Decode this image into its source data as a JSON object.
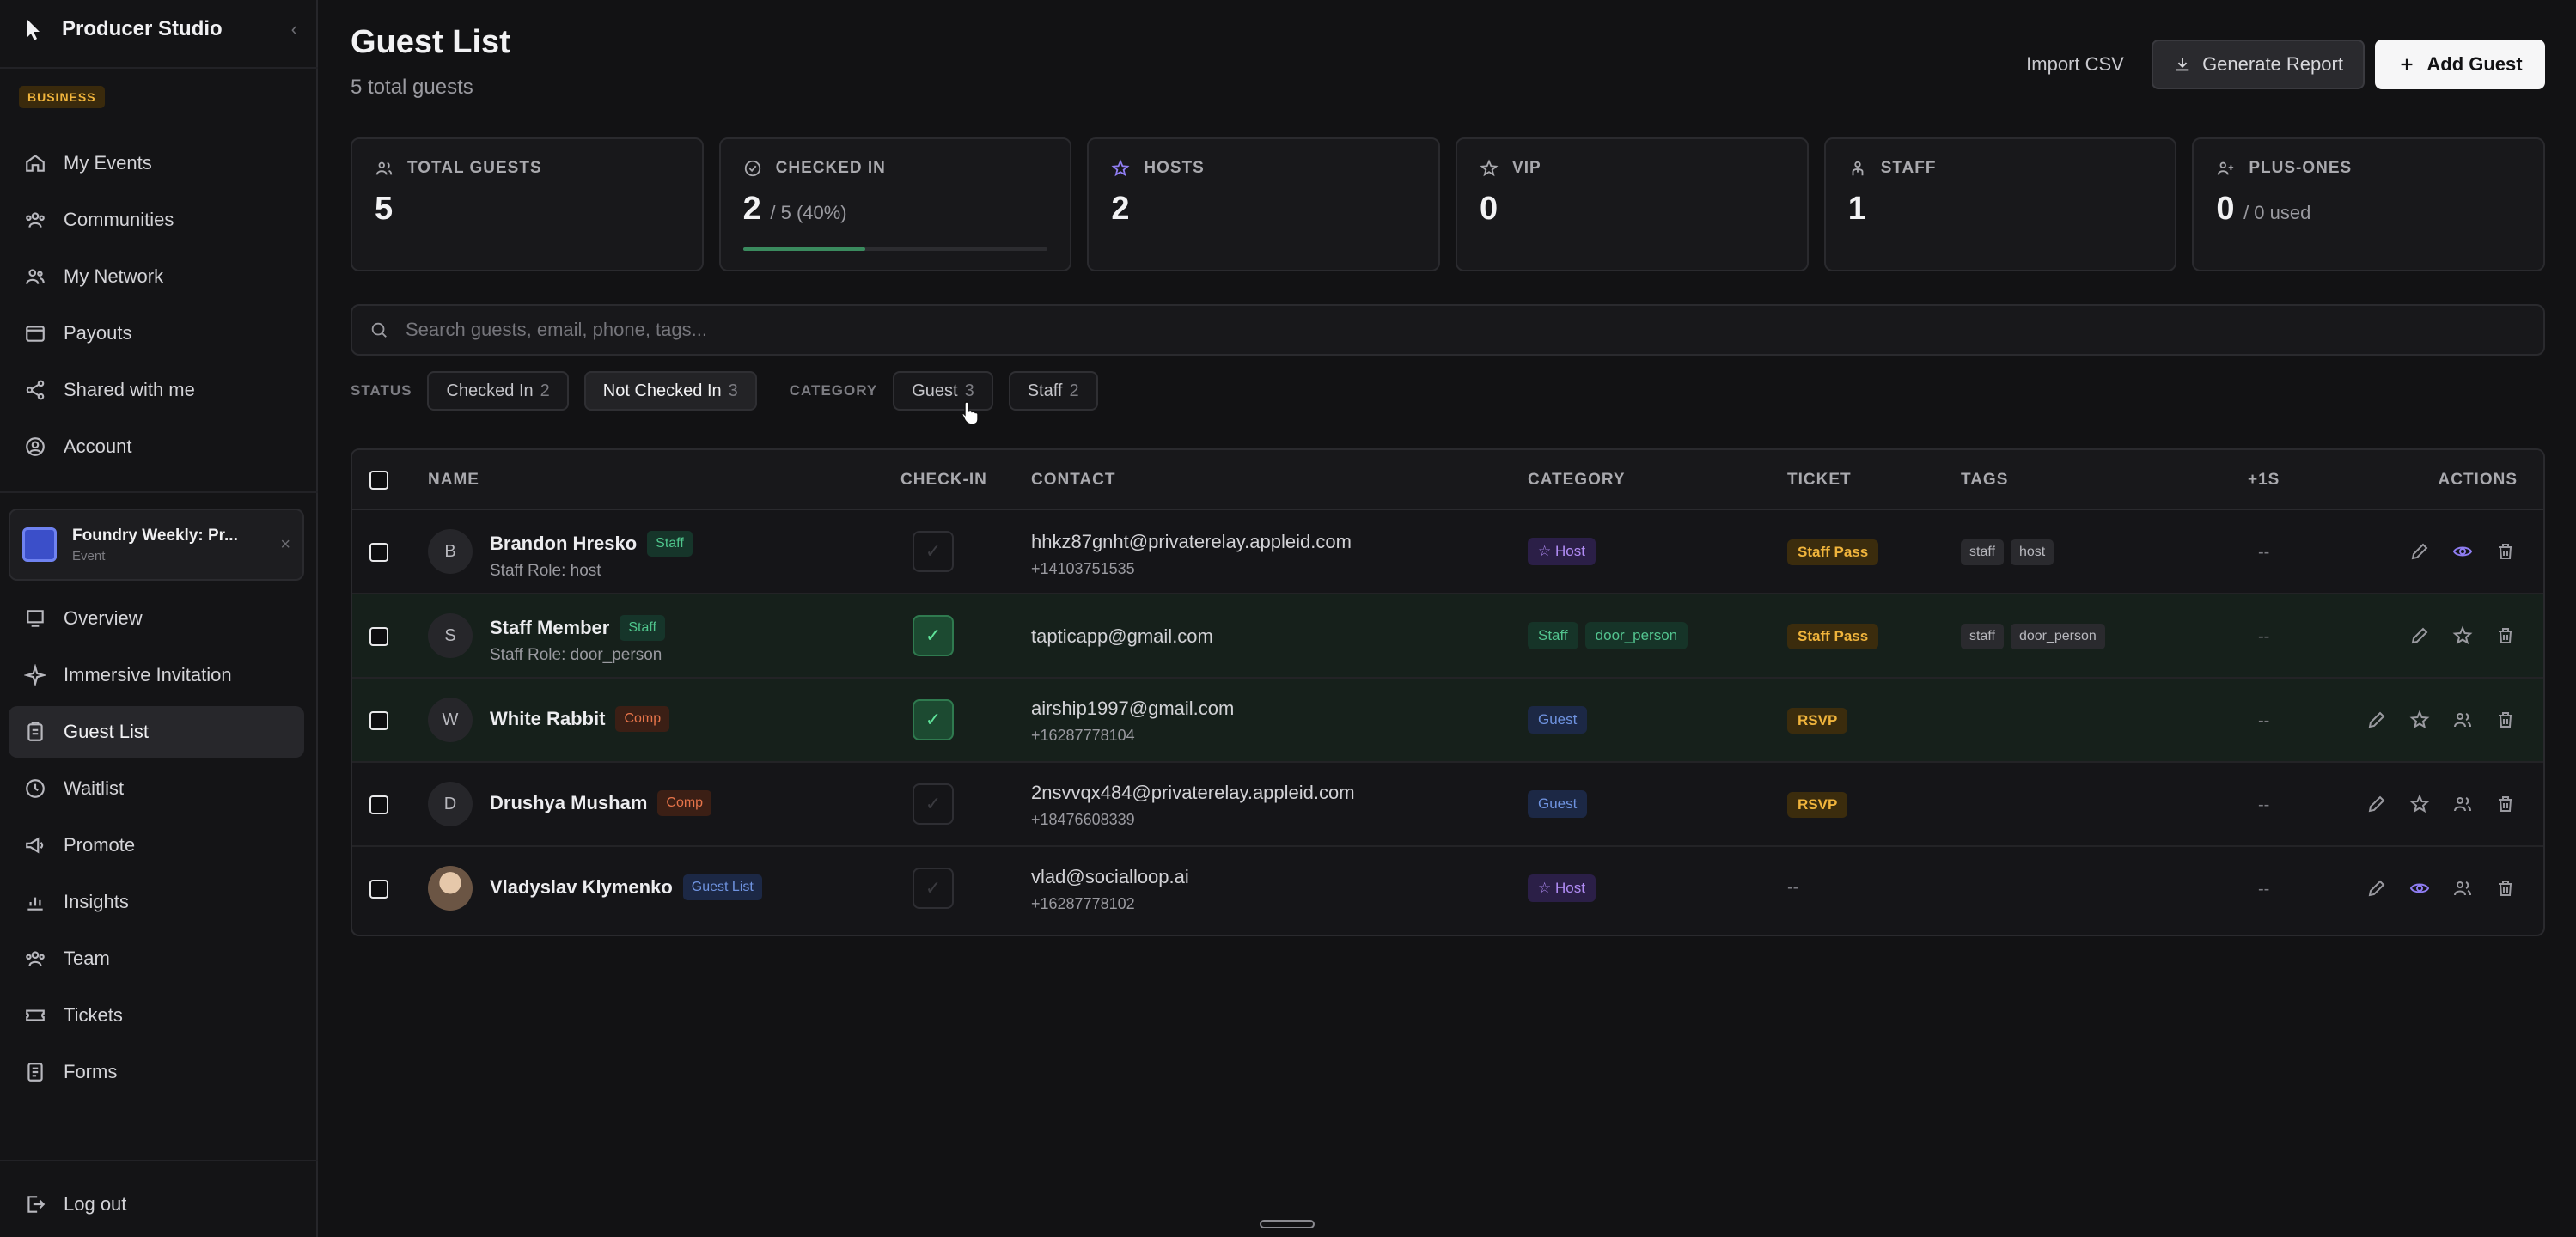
{
  "app": {
    "name": "Producer Studio",
    "plan_badge": "BUSINESS"
  },
  "sidebar": {
    "top_items": [
      {
        "label": "My Events",
        "icon": "home-icon"
      },
      {
        "label": "Communities",
        "icon": "users-icon"
      },
      {
        "label": "My Network",
        "icon": "network-icon"
      },
      {
        "label": "Payouts",
        "icon": "wallet-icon"
      },
      {
        "label": "Shared with me",
        "icon": "share-icon"
      },
      {
        "label": "Account",
        "icon": "account-icon"
      }
    ],
    "event": {
      "title": "Foundry Weekly: Pr...",
      "sub": "Event"
    },
    "event_items": [
      {
        "label": "Overview",
        "icon": "overview-icon"
      },
      {
        "label": "Immersive Invitation",
        "icon": "sparkle-icon"
      },
      {
        "label": "Guest List",
        "icon": "guest-list-icon",
        "active": true
      },
      {
        "label": "Waitlist",
        "icon": "clock-icon"
      },
      {
        "label": "Promote",
        "icon": "megaphone-icon"
      },
      {
        "label": "Insights",
        "icon": "chart-icon"
      },
      {
        "label": "Team",
        "icon": "team-icon"
      },
      {
        "label": "Tickets",
        "icon": "ticket-icon"
      },
      {
        "label": "Forms",
        "icon": "forms-icon"
      }
    ],
    "logout": "Log out"
  },
  "header": {
    "title": "Guest List",
    "subtitle": "5 total guests",
    "import_label": "Import CSV",
    "report_label": "Generate Report",
    "add_label": "Add Guest"
  },
  "stats": [
    {
      "label": "TOTAL GUESTS",
      "value": "5",
      "sub": "",
      "icon": "users-icon"
    },
    {
      "label": "CHECKED IN",
      "value": "2",
      "sub": "/ 5 (40%)",
      "icon": "check-circle-icon",
      "progress": 0.4
    },
    {
      "label": "HOSTS",
      "value": "2",
      "sub": "",
      "icon": "star-icon"
    },
    {
      "label": "VIP",
      "value": "0",
      "sub": "",
      "icon": "star-outline-icon"
    },
    {
      "label": "STAFF",
      "value": "1",
      "sub": "",
      "icon": "staff-icon"
    },
    {
      "label": "PLUS-ONES",
      "value": "0",
      "sub": "/ 0 used",
      "icon": "user-plus-icon"
    }
  ],
  "search": {
    "placeholder": "Search guests, email, phone, tags..."
  },
  "filters": {
    "status_label": "STATUS",
    "category_label": "CATEGORY",
    "status": [
      {
        "label": "Checked In",
        "count": "2"
      },
      {
        "label": "Not Checked In",
        "count": "3",
        "selected": true
      }
    ],
    "category": [
      {
        "label": "Guest",
        "count": "3"
      },
      {
        "label": "Staff",
        "count": "2"
      }
    ]
  },
  "table": {
    "headers": {
      "name": "NAME",
      "checkin": "CHECK-IN",
      "contact": "CONTACT",
      "category": "CATEGORY",
      "ticket": "TICKET",
      "tags": "TAGS",
      "plus": "+1S",
      "actions": "ACTIONS"
    },
    "rows": [
      {
        "initial": "B",
        "name": "Brandon Hresko",
        "badge": "Staff",
        "role": "Staff Role: host",
        "checked_in": false,
        "email": "hhkz87gnht@privaterelay.appleid.com",
        "phone": "+14103751535",
        "categories": [
          "☆ Host"
        ],
        "ticket": "Staff Pass",
        "tags": [
          "staff",
          "host"
        ],
        "plus": "--"
      },
      {
        "initial": "S",
        "name": "Staff Member",
        "badge": "Staff",
        "role": "Staff Role: door_person",
        "checked_in": true,
        "email": "tapticapp@gmail.com",
        "phone": "",
        "categories": [
          "Staff",
          "door_person"
        ],
        "ticket": "Staff Pass",
        "tags": [
          "staff",
          "door_person"
        ],
        "plus": "--"
      },
      {
        "initial": "W",
        "name": "White Rabbit",
        "badge": "Comp",
        "role": "",
        "checked_in": true,
        "email": "airship1997@gmail.com",
        "phone": "+16287778104",
        "categories": [
          "Guest"
        ],
        "ticket": "RSVP",
        "tags": [],
        "plus": "--"
      },
      {
        "initial": "D",
        "name": "Drushya Musham",
        "badge": "Comp",
        "role": "",
        "checked_in": false,
        "email": "2nsvvqx484@privaterelay.appleid.com",
        "phone": "+18476608339",
        "categories": [
          "Guest"
        ],
        "ticket": "RSVP",
        "tags": [],
        "plus": "--"
      },
      {
        "initial": "",
        "name": "Vladyslav Klymenko",
        "badge": "Guest List",
        "role": "",
        "checked_in": false,
        "email": "vlad@socialloop.ai",
        "phone": "+16287778102",
        "categories": [
          "☆ Host"
        ],
        "ticket": "--",
        "tags": [],
        "plus": "--"
      }
    ]
  },
  "colors": {
    "accent_green": "#4fc58c",
    "host_purple": "#b18cf5",
    "guest_blue": "#6f93e0",
    "ticket_gold": "#f0b43c",
    "comp_orange": "#e6744a",
    "background": "#121214"
  }
}
